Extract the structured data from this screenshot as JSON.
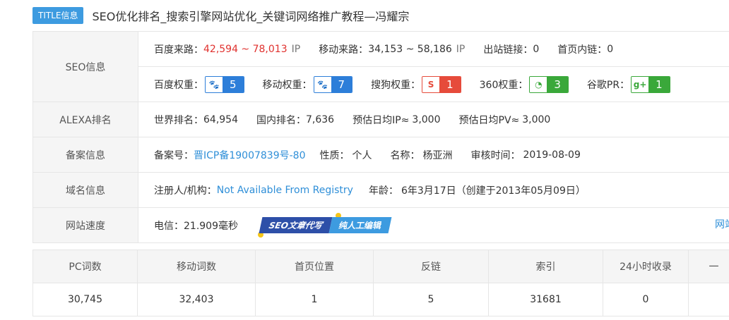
{
  "title": {
    "tag": "TITLE信息",
    "text": "SEO优化排名_搜索引擎网站优化_关键词网络推广教程—冯耀宗"
  },
  "seo": {
    "label": "SEO信息",
    "baidu_traffic_label": "百度来路：",
    "baidu_traffic_value": "42,594 ~ 78,013",
    "baidu_traffic_unit": "IP",
    "mobile_traffic_label": "移动来路：",
    "mobile_traffic_value": "34,153 ~ 58,186",
    "mobile_traffic_unit": "IP",
    "outlinks_label": "出站链接：",
    "outlinks_value": "0",
    "homelinks_label": "首页内链：",
    "homelinks_value": "0",
    "baidu_weight_label": "百度权重：",
    "baidu_weight_value": "5",
    "mobile_weight_label": "移动权重：",
    "mobile_weight_value": "7",
    "sogou_weight_label": "搜狗权重：",
    "sogou_weight_value": "1",
    "w360_label": "360权重：",
    "w360_value": "3",
    "google_pr_label": "谷歌PR：",
    "google_pr_value": "1",
    "sogou_icon_text": "S",
    "google_icon_text": "g+"
  },
  "alexa": {
    "label": "ALEXA排名",
    "world_label": "世界排名：",
    "world_value": "64,954",
    "domestic_label": "国内排名：",
    "domestic_value": "7,636",
    "ip_label": "预估日均IP≈",
    "ip_value": "3,000",
    "pv_label": "预估日均PV≈",
    "pv_value": "3,000"
  },
  "icp": {
    "label": "备案信息",
    "no_label": "备案号：",
    "no_value": "晋ICP备19007839号-80",
    "type_label": "性质：",
    "type_value": "个人",
    "name_label": "名称：",
    "name_value": "杨亚洲",
    "date_label": "审核时间：",
    "date_value": "2019-08-09"
  },
  "domain": {
    "label": "域名信息",
    "registrant_label": "注册人/机构：",
    "registrant_value": "Not Available From Registry",
    "age_label": "年龄：",
    "age_value": "6年3月17日",
    "created": "（创建于2013年05月09日）"
  },
  "speed": {
    "label": "网站速度",
    "telecom": "电信：21.909毫秒",
    "promo_left": "SEO文章代写",
    "promo_right": "纯人工编辑",
    "link": "网站估"
  },
  "stats": {
    "headers": [
      "PC词数",
      "移动词数",
      "首页位置",
      "反链",
      "索引",
      "24小时收录",
      "一"
    ],
    "values": [
      "30,745",
      "32,403",
      "1",
      "5",
      "31681",
      "0",
      ""
    ]
  }
}
